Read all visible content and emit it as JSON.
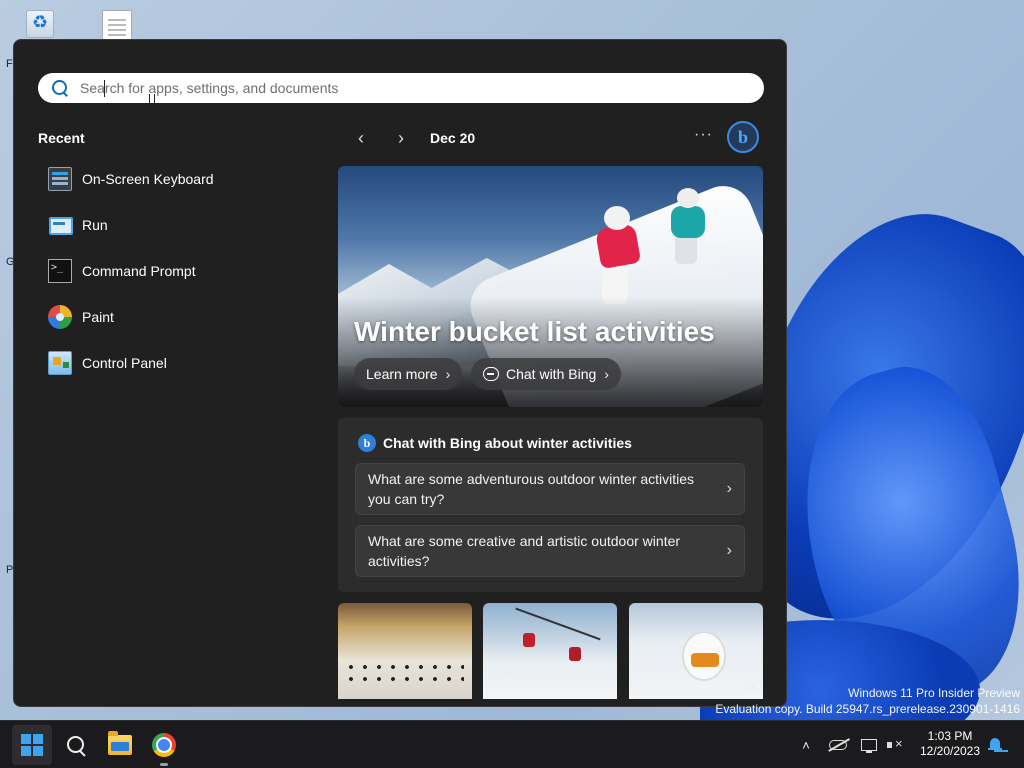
{
  "desktop": {
    "edge_letters": [
      "F",
      "G",
      "P"
    ],
    "watermark": {
      "line1": "Windows 11 Pro Insider Preview",
      "line2": "Evaluation copy. Build 25947.rs_prerelease.230901-1416"
    }
  },
  "search": {
    "placeholder": "Search for apps, settings, and documents",
    "value": ""
  },
  "recent": {
    "title": "Recent",
    "items": [
      {
        "label": "On-Screen Keyboard",
        "icon": "keyboard-icon"
      },
      {
        "label": "Run",
        "icon": "run-icon"
      },
      {
        "label": "Command Prompt",
        "icon": "command-prompt-icon"
      },
      {
        "label": "Paint",
        "icon": "paint-icon"
      },
      {
        "label": "Control Panel",
        "icon": "control-panel-icon"
      }
    ]
  },
  "highlights": {
    "prev_glyph": "‹",
    "next_glyph": "›",
    "date": "Dec 20",
    "more_glyph": "···",
    "bing_glyph": "b",
    "hero": {
      "title": "Winter bucket list activities",
      "learn_more": "Learn more",
      "chat_with_bing": "Chat with Bing",
      "chevron": "›"
    },
    "chat_card": {
      "title": "Chat with Bing about winter activities",
      "bing_glyph": "b",
      "questions": [
        "What are some adventurous outdoor winter activities you can try?",
        "What are some creative and artistic outdoor winter activities?"
      ],
      "chevron": "›"
    },
    "thumb_next_glyph": "▶"
  },
  "taskbar": {
    "apps": [
      "start",
      "search",
      "file-explorer",
      "chrome"
    ],
    "tray_up_glyph": "˄",
    "clock": {
      "time": "1:03 PM",
      "date": "12/20/2023"
    }
  },
  "colors": {
    "accent": "#3ea4f0",
    "panel": "#202020",
    "taskbar": "#1b1b1d"
  }
}
